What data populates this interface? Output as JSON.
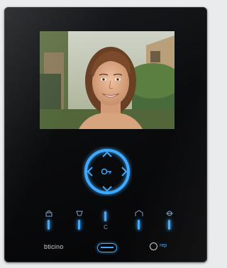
{
  "device": {
    "brand": "bticino",
    "accent_color": "#3fa9ff",
    "screen_content": "visitor-face-photo"
  },
  "navigation": {
    "center_icon": "key-unlock-icon",
    "up_icon": "arrow-up-icon",
    "down_icon": "arrow-down-icon",
    "left_icon": "arrow-left-icon",
    "right_icon": "arrow-right-icon"
  },
  "function_keys": [
    {
      "icon": "door-lock-icon",
      "led": "on"
    },
    {
      "icon": "light-icon",
      "led": "on"
    },
    {
      "icon": "",
      "label": "C",
      "led": "on"
    },
    {
      "icon": "gate-icon",
      "led": "on"
    },
    {
      "icon": "settings-icon",
      "led": "on"
    }
  ],
  "power": {
    "tag": "rep"
  }
}
